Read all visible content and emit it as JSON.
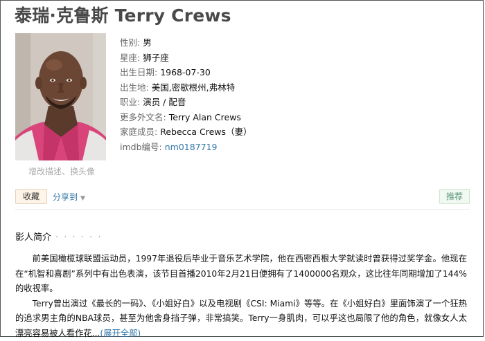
{
  "title": "泰瑞·克鲁斯 Terry Crews",
  "photo": {
    "edit_link": "增改描述、换头像"
  },
  "info": {
    "gender_label": "性别:",
    "gender": "男",
    "constellation_label": "星座:",
    "constellation": "狮子座",
    "birthdate_label": "出生日期:",
    "birthdate": "1968-07-30",
    "birthplace_label": "出生地:",
    "birthplace": "美国,密歇根州,弗林特",
    "profession_label": "职业:",
    "profession": "演员 / 配音",
    "alt_names_label": "更多外文名:",
    "alt_names": "Terry Alan Crews",
    "family_label": "家庭成员:",
    "family": "Rebecca Crews（妻）",
    "imdb_label": "imdb编号:",
    "imdb": "nm0187719"
  },
  "actions": {
    "collect": "收藏",
    "share": "分享到",
    "recommend": "推荐"
  },
  "intro": {
    "heading": "影人简介",
    "dots": "· · · · · ·",
    "paragraph1": "前美国橄榄球联盟运动员，1997年退役后毕业于音乐艺术学院，他在西密西根大学就读时曾获得过奖学金。他现在在“机智和喜剧”系列中有出色表演，该节目首播2010年2月21日便拥有了1400000名观众，这比往年同期增加了144%的收视率。",
    "paragraph2": "Terry曾出演过《最长的一码》、《小姐好白》以及电视剧《CSI: Miami》等等。在《小姐好白》里面饰演了一个狂热的追求男主角的NBA球员，甚至为他舍身挡子弹，非常搞笑。Terry一身肌肉，可以乎这也局限了他的角色，就像女人太漂亮容易被人看作花...",
    "expand": "(展开全部)"
  }
}
